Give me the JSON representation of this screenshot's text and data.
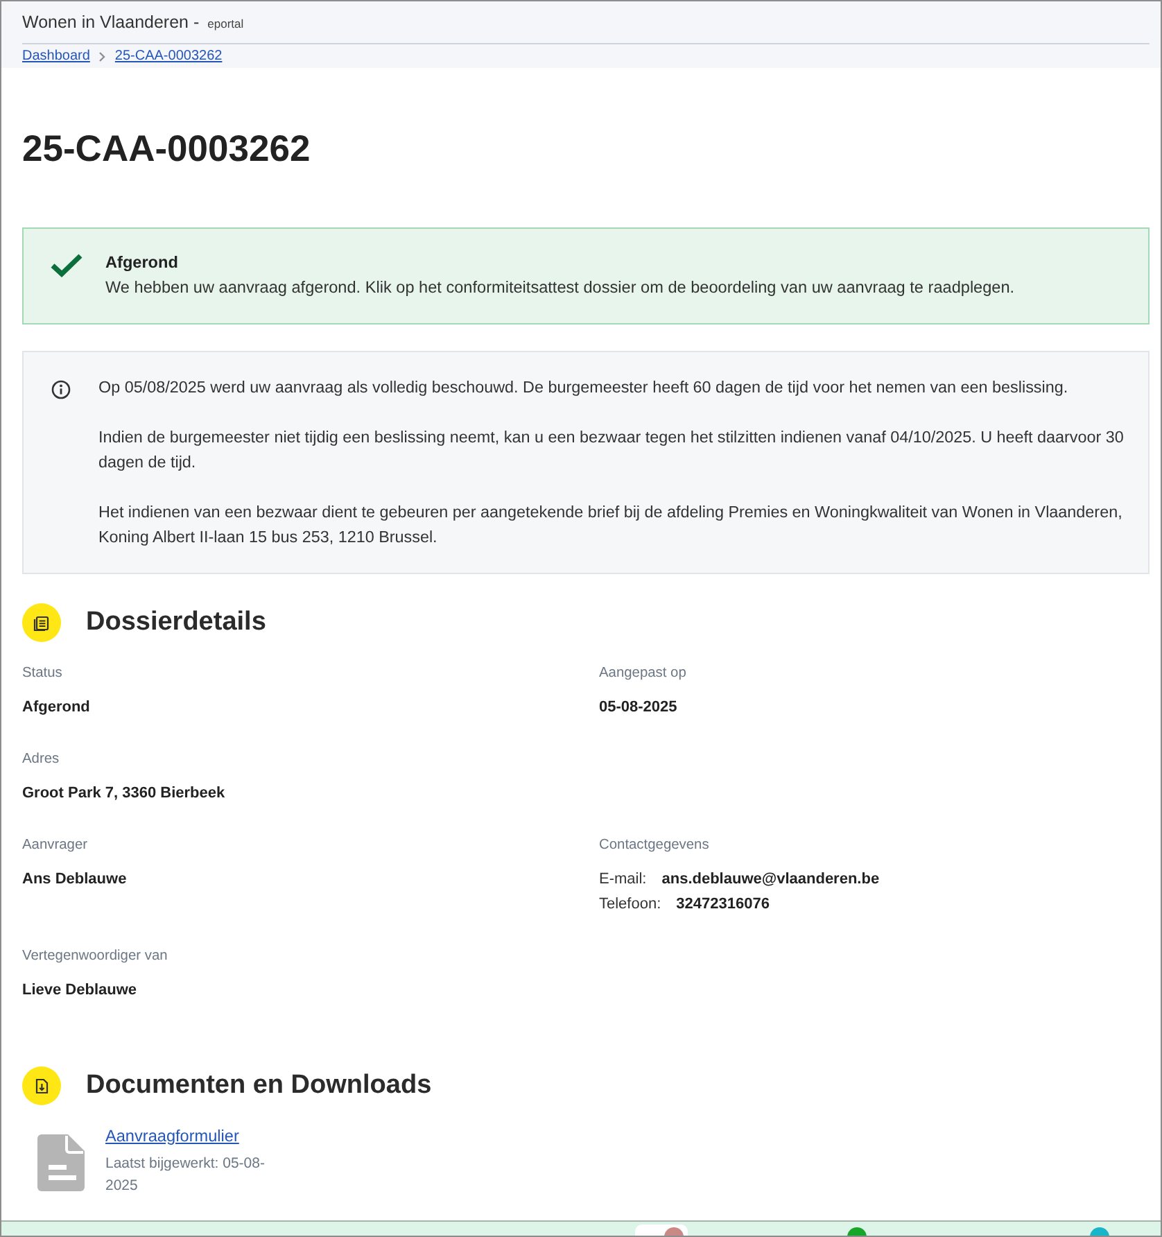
{
  "header": {
    "title": "Wonen in Vlaanderen -",
    "subtitle": "eportal"
  },
  "breadcrumb": [
    {
      "label": "Dashboard"
    },
    {
      "label": "25-CAA-0003262"
    }
  ],
  "page_title": "25-CAA-0003262",
  "status_alert": {
    "kind": "success",
    "title": "Afgerond",
    "message": "We hebben uw aanvraag afgerond. Klik op het conformiteitsattest dossier om de beoordeling van uw aanvraag te raadplegen."
  },
  "info_notice": {
    "paragraphs": [
      "Op 05/08/2025 werd uw aanvraag als volledig beschouwd. De burgemeester heeft 60 dagen de tijd voor het nemen van een beslissing.",
      "Indien de burgemeester niet tijdig een beslissing neemt, kan u een bezwaar tegen het stilzitten indienen vanaf 04/10/2025. U heeft daarvoor 30 dagen de tijd.",
      "Het indienen van een bezwaar dient te gebeuren per aangetekende brief bij de afdeling Premies en Woningkwaliteit van Wonen in Vlaanderen, Koning Albert II-laan 15 bus 253, 1210 Brussel."
    ]
  },
  "sections": [
    {
      "kind": "details",
      "title": "Dossierdetails",
      "rows": [
        [
          {
            "label": "Status",
            "value": "Afgerond"
          },
          {
            "label": "Aangepast op",
            "value": "05-08-2025"
          }
        ],
        [
          {
            "label": "Adres",
            "value": "Groot Park 7, 3360 Bierbeek"
          }
        ],
        [
          {
            "label": "Aanvrager",
            "value": "Ans Deblauwe"
          },
          {
            "label": "Contactgegevens",
            "contacts": [
              {
                "label": "E-mail:",
                "value": "ans.deblauwe@vlaanderen.be"
              },
              {
                "label": "Telefoon:",
                "value": "32472316076"
              }
            ]
          }
        ],
        [
          {
            "label": "Vertegenwoordiger van",
            "value": "Lieve Deblauwe"
          }
        ]
      ]
    },
    {
      "kind": "documents",
      "title": "Documenten en Downloads",
      "documents": [
        {
          "name": "Aanvraagformulier",
          "updated": "Laatst bijgewerkt: 05-08-2025"
        }
      ]
    }
  ]
}
